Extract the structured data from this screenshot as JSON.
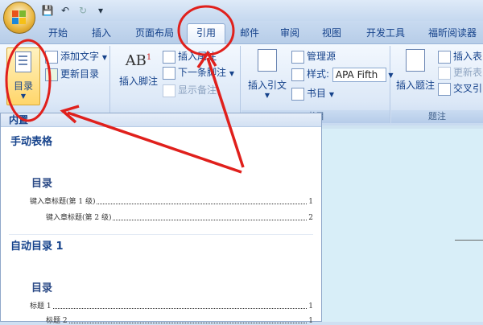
{
  "quick_access": {
    "save_icon": "💾",
    "undo_icon": "↶",
    "redo_icon": "↻",
    "more_icon": "▾"
  },
  "tabs": [
    "开始",
    "插入",
    "页面布局",
    "引用",
    "邮件",
    "审阅",
    "视图",
    "开发工具",
    "福昕阅读器"
  ],
  "active_tab": "引用",
  "ribbon": {
    "toc": {
      "label": "目录",
      "add_text": "添加文字",
      "update_toc": "更新目录"
    },
    "footnotes": {
      "insert_footnote": "插入脚注",
      "insert_endnote": "插入尾注",
      "next_footnote": "下一条脚注",
      "show_notes": "显示备注",
      "ab_glyph": "AB",
      "sup_glyph": "1"
    },
    "citations": {
      "insert_citation": "插入引文",
      "manage_sources": "管理源",
      "style_label": "样式:",
      "style_value": "APA Fifth",
      "bibliography": "书目",
      "group_label": "书目"
    },
    "captions": {
      "insert_caption": "插入题注",
      "insert_table_fig": "插入表",
      "update_table": "更新表",
      "cross_ref": "交叉引",
      "group_label": "题注"
    }
  },
  "dropdown": {
    "header": "内置",
    "sections": [
      {
        "name": "手动表格",
        "toc_title": "目录",
        "rows": [
          {
            "text": "键入章标题(第 1 级)",
            "page": "1"
          },
          {
            "text": "键入章标题(第 2 级)",
            "page": "2"
          }
        ]
      },
      {
        "name": "自动目录 1",
        "toc_title": "目录",
        "rows": [
          {
            "text": "标题 1",
            "page": "1"
          },
          {
            "text": "标题 2",
            "page": "1"
          }
        ]
      }
    ]
  },
  "colors": {
    "annotation": "#e0201c",
    "accent": "#15428b"
  }
}
